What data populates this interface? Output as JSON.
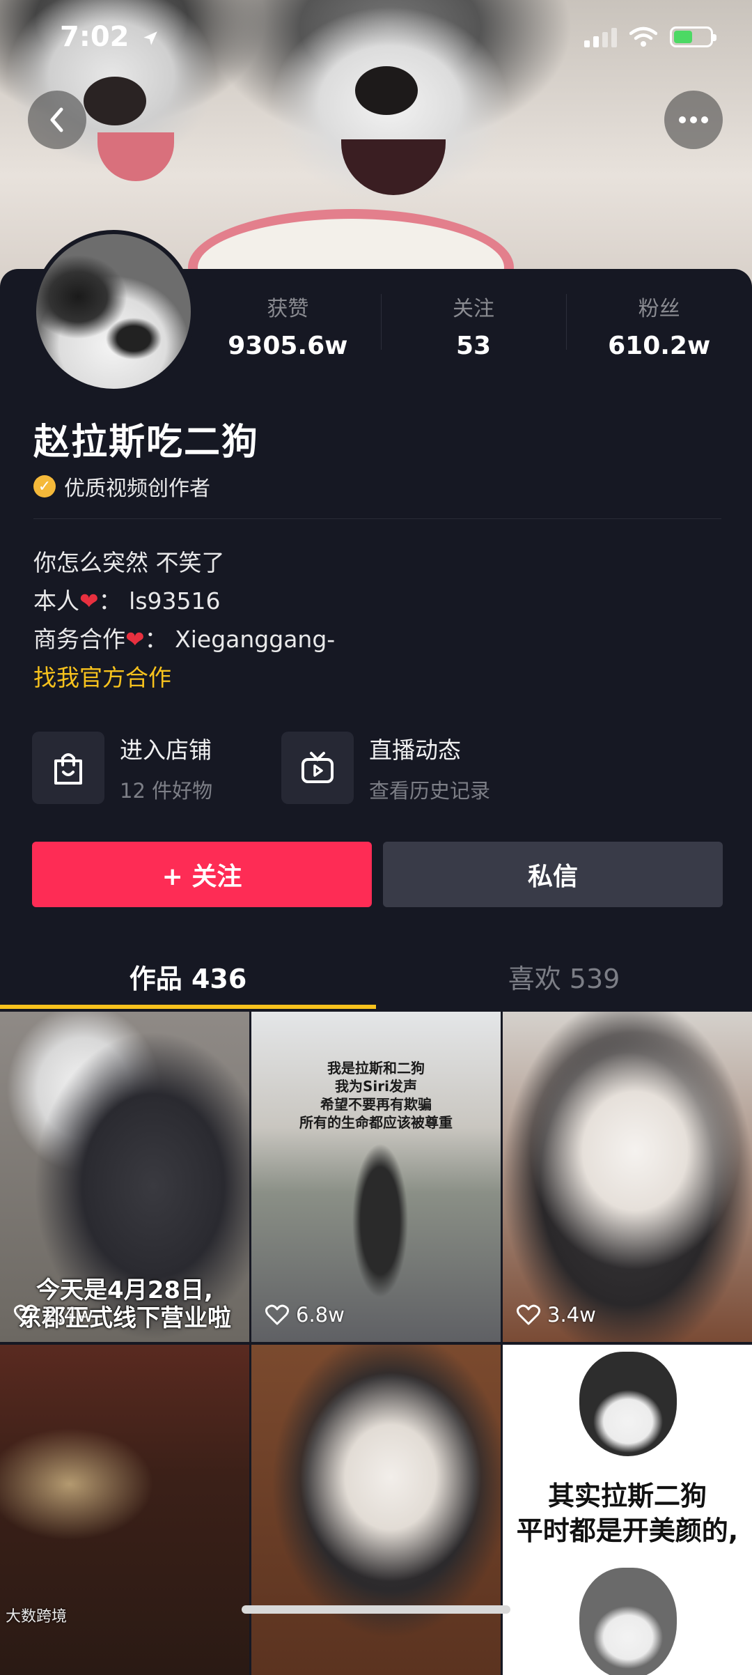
{
  "status_bar": {
    "time": "7:02"
  },
  "header": {
    "back_icon": "chevron-left-icon",
    "more_icon": "ellipsis-icon"
  },
  "profile": {
    "stats": [
      {
        "label": "获赞",
        "value": "9305.6w"
      },
      {
        "label": "关注",
        "value": "53"
      },
      {
        "label": "粉丝",
        "value": "610.2w"
      }
    ],
    "username": "赵拉斯吃二狗",
    "badge": "优质视频创作者",
    "bio": {
      "line1": "你怎么突然 不笑了",
      "line2_prefix": "本人",
      "line2_suffix": "： ls93516",
      "line3_prefix": "商务合作",
      "line3_suffix": "： Xieganggang-",
      "link": "找我官方合作"
    },
    "entries": [
      {
        "title": "进入店铺",
        "subtitle": "12 件好物",
        "icon": "shopping-bag-icon"
      },
      {
        "title": "直播动态",
        "subtitle": "查看历史记录",
        "icon": "tv-play-icon"
      }
    ],
    "follow_label": "+ 关注",
    "message_label": "私信"
  },
  "tabs": [
    {
      "label": "作品 436",
      "active": true
    },
    {
      "label": "喜欢 539",
      "active": false
    }
  ],
  "videos": [
    {
      "likes": "2.4w",
      "caption": "今天是4月28日,\n东郡正式线下营业啦"
    },
    {
      "likes": "6.8w",
      "caption": "我是拉斯和二狗\n我为Siri发声\n希望不要再有欺骗\n所有的生命都应该被尊重"
    },
    {
      "likes": "3.4w",
      "caption": ""
    },
    {
      "likes": "",
      "caption": ""
    },
    {
      "likes": "",
      "caption": ""
    },
    {
      "likes": "",
      "caption": "其实拉斯二狗\n平时都是开美颜的,"
    }
  ],
  "watermark": "大数跨境",
  "colors": {
    "accent": "#fe2c55",
    "link": "#f7c21d",
    "badge": "#f5b93a",
    "background": "#161823"
  }
}
